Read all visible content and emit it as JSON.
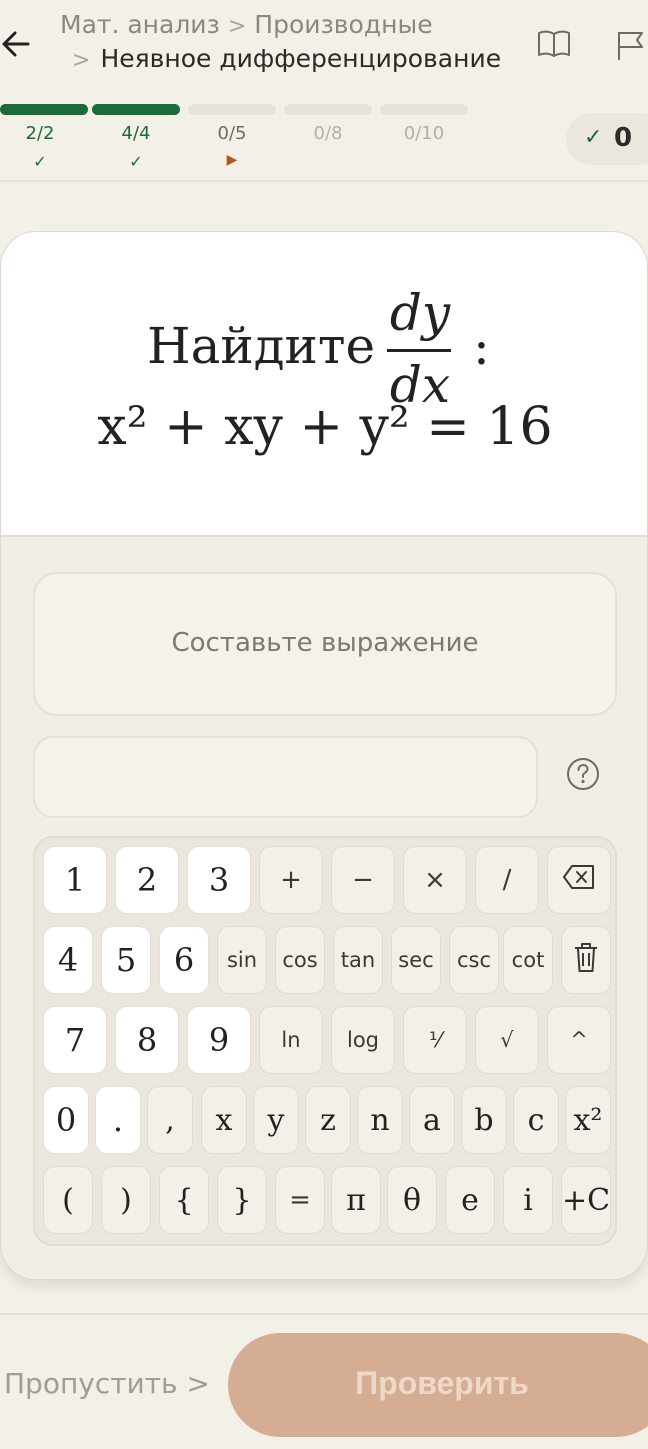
{
  "header": {
    "breadcrumb": [
      "Мат. анализ",
      "Производные",
      "Неявное дифференцирование"
    ],
    "sep": ">"
  },
  "progress": [
    {
      "label": "2/2",
      "status": "done"
    },
    {
      "label": "4/4",
      "status": "done"
    },
    {
      "label": "0/5",
      "status": "current"
    },
    {
      "label": "0/8",
      "status": "pending"
    },
    {
      "label": "0/10",
      "status": "pending"
    }
  ],
  "score": {
    "check": "✓",
    "value": "0"
  },
  "question": {
    "prompt": "Найдите",
    "fraction": {
      "numerator": "dy",
      "denominator": "dx"
    },
    "colon": ":",
    "equation": "x² + xy + y² = 16"
  },
  "answer": {
    "compose_placeholder": "Составьте выражение",
    "input_value": ""
  },
  "keypad": {
    "rows": [
      [
        {
          "label": "1",
          "kind": "num"
        },
        {
          "label": "2",
          "kind": "num"
        },
        {
          "label": "3",
          "kind": "num"
        },
        {
          "label": "+",
          "kind": "op"
        },
        {
          "label": "−",
          "kind": "op"
        },
        {
          "label": "×",
          "kind": "op"
        },
        {
          "label": "/",
          "kind": "op"
        },
        {
          "label": "",
          "kind": "icon",
          "icon": "backspace-icon"
        }
      ],
      [
        {
          "label": "4",
          "kind": "num"
        },
        {
          "label": "5",
          "kind": "num"
        },
        {
          "label": "6",
          "kind": "num"
        },
        {
          "label": "sin",
          "kind": "fn"
        },
        {
          "label": "cos",
          "kind": "fn"
        },
        {
          "label": "tan",
          "kind": "fn"
        },
        {
          "label": "sec",
          "kind": "fn"
        },
        {
          "label": "csc",
          "kind": "fn"
        },
        {
          "label": "cot",
          "kind": "fn"
        },
        {
          "label": "",
          "kind": "icon",
          "icon": "trash-icon"
        }
      ],
      [
        {
          "label": "7",
          "kind": "num"
        },
        {
          "label": "8",
          "kind": "num"
        },
        {
          "label": "9",
          "kind": "num"
        },
        {
          "label": "ln",
          "kind": "fn"
        },
        {
          "label": "log",
          "kind": "fn"
        },
        {
          "label": "¹⁄",
          "kind": "fn"
        },
        {
          "label": "√",
          "kind": "fn"
        },
        {
          "label": "^",
          "kind": "fn"
        }
      ],
      [
        {
          "label": "0",
          "kind": "num"
        },
        {
          "label": ".",
          "kind": "num"
        },
        {
          "label": ",",
          "kind": "var"
        },
        {
          "label": "x",
          "kind": "var"
        },
        {
          "label": "y",
          "kind": "var"
        },
        {
          "label": "z",
          "kind": "var"
        },
        {
          "label": "n",
          "kind": "var"
        },
        {
          "label": "a",
          "kind": "var"
        },
        {
          "label": "b",
          "kind": "var"
        },
        {
          "label": "c",
          "kind": "var"
        },
        {
          "label": "x²",
          "kind": "var"
        }
      ],
      [
        {
          "label": "(",
          "kind": "var"
        },
        {
          "label": ")",
          "kind": "var"
        },
        {
          "label": "{",
          "kind": "var"
        },
        {
          "label": "}",
          "kind": "var"
        },
        {
          "label": "=",
          "kind": "op"
        },
        {
          "label": "π",
          "kind": "var"
        },
        {
          "label": "θ",
          "kind": "var"
        },
        {
          "label": "e",
          "kind": "var"
        },
        {
          "label": "i",
          "kind": "var"
        },
        {
          "label": "+C",
          "kind": "var"
        }
      ]
    ]
  },
  "footer": {
    "skip_label": "Пропустить",
    "skip_chevron": ">",
    "check_label": "Проверить"
  },
  "colors": {
    "accent_green": "#1c6b3a",
    "check_button": "#d4ad92",
    "current_marker": "#b05a1e"
  }
}
